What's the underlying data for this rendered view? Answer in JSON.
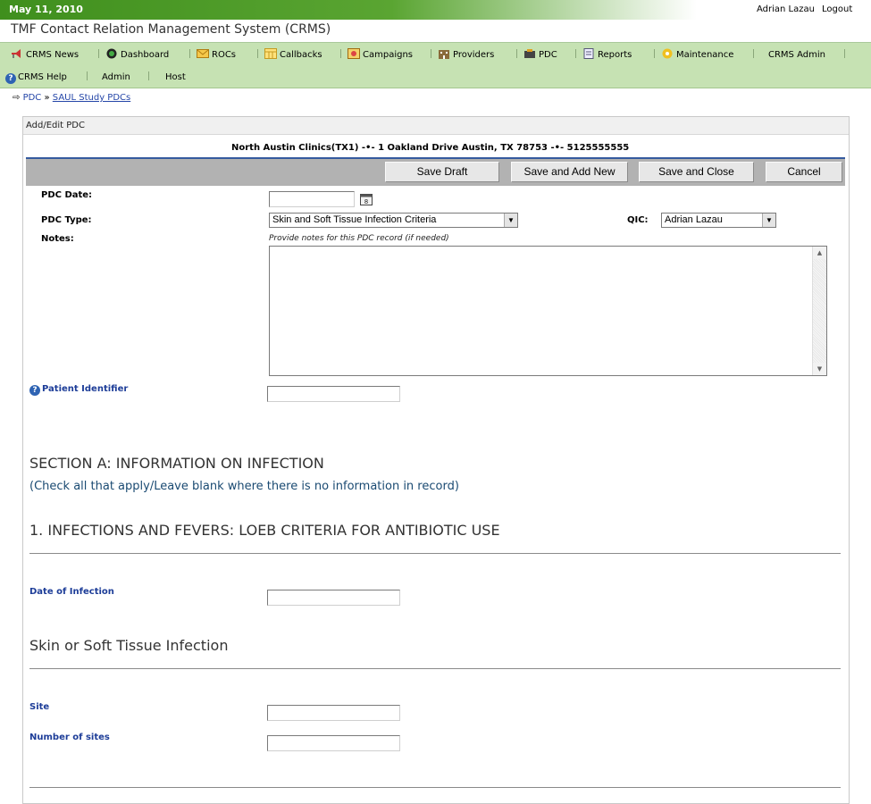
{
  "topbar": {
    "date": "May 11, 2010",
    "user": "Adrian Lazau",
    "logout": "Logout"
  },
  "app": {
    "title": "TMF Contact Relation Management System (CRMS)"
  },
  "nav": {
    "items": [
      {
        "label": "CRMS News",
        "icon": "megaphone-icon"
      },
      {
        "label": "Dashboard",
        "icon": "dashboard-icon"
      },
      {
        "label": "ROCs",
        "icon": "envelope-icon"
      },
      {
        "label": "Callbacks",
        "icon": "calendar-icon"
      },
      {
        "label": "Campaigns",
        "icon": "campaign-icon"
      },
      {
        "label": "Providers",
        "icon": "building-icon"
      },
      {
        "label": "PDC",
        "icon": "pdc-icon"
      },
      {
        "label": "Reports",
        "icon": "report-icon"
      },
      {
        "label": "Maintenance",
        "icon": "gear-icon"
      },
      {
        "label": "CRMS Admin",
        "icon": ""
      },
      {
        "label": "CRMS Help",
        "icon": "help-icon"
      },
      {
        "label": "Admin",
        "icon": ""
      },
      {
        "label": "Host",
        "icon": ""
      }
    ]
  },
  "breadcrumb": {
    "root": "PDC",
    "separator": "»",
    "current": "SAUL Study PDCs"
  },
  "panel": {
    "title": "Add/Edit PDC",
    "address": "North Austin Clinics(TX1)  -•-  1 Oakland Drive Austin, TX 78753  -•-  5125555555"
  },
  "buttons": {
    "save_draft": "Save Draft",
    "save_add_new": "Save and Add New",
    "save_close": "Save and Close",
    "cancel": "Cancel"
  },
  "form": {
    "pdc_date_label": "PDC Date:",
    "pdc_date_value": "",
    "pdc_type_label": "PDC Type:",
    "pdc_type_value": "Skin and Soft Tissue Infection Criteria",
    "qic_label": "QIC:",
    "qic_value": "Adrian Lazau",
    "notes_label": "Notes:",
    "notes_hint": "Provide notes for this PDC record (if needed)",
    "notes_value": "",
    "patient_identifier_label": "Patient Identifier",
    "patient_identifier_value": ""
  },
  "section_a": {
    "title": "SECTION A: INFORMATION ON INFECTION",
    "subtitle": "(Check all that apply/Leave blank where there is no information in record)",
    "q1_title": "1. INFECTIONS AND FEVERS: LOEB CRITERIA FOR ANTIBIOTIC USE",
    "date_of_infection_label": "Date of Infection",
    "date_of_infection_value": "",
    "skin_title": "Skin or Soft Tissue Infection",
    "site_label": "Site",
    "site_value": "",
    "number_of_sites_label": "Number of sites",
    "number_of_sites_value": ""
  },
  "colors": {
    "topbar_green": "#3f8f1d",
    "nav_green": "#c6e2b3",
    "accent_blue": "#1d3d98",
    "button_bar": "#b2b2b2"
  }
}
